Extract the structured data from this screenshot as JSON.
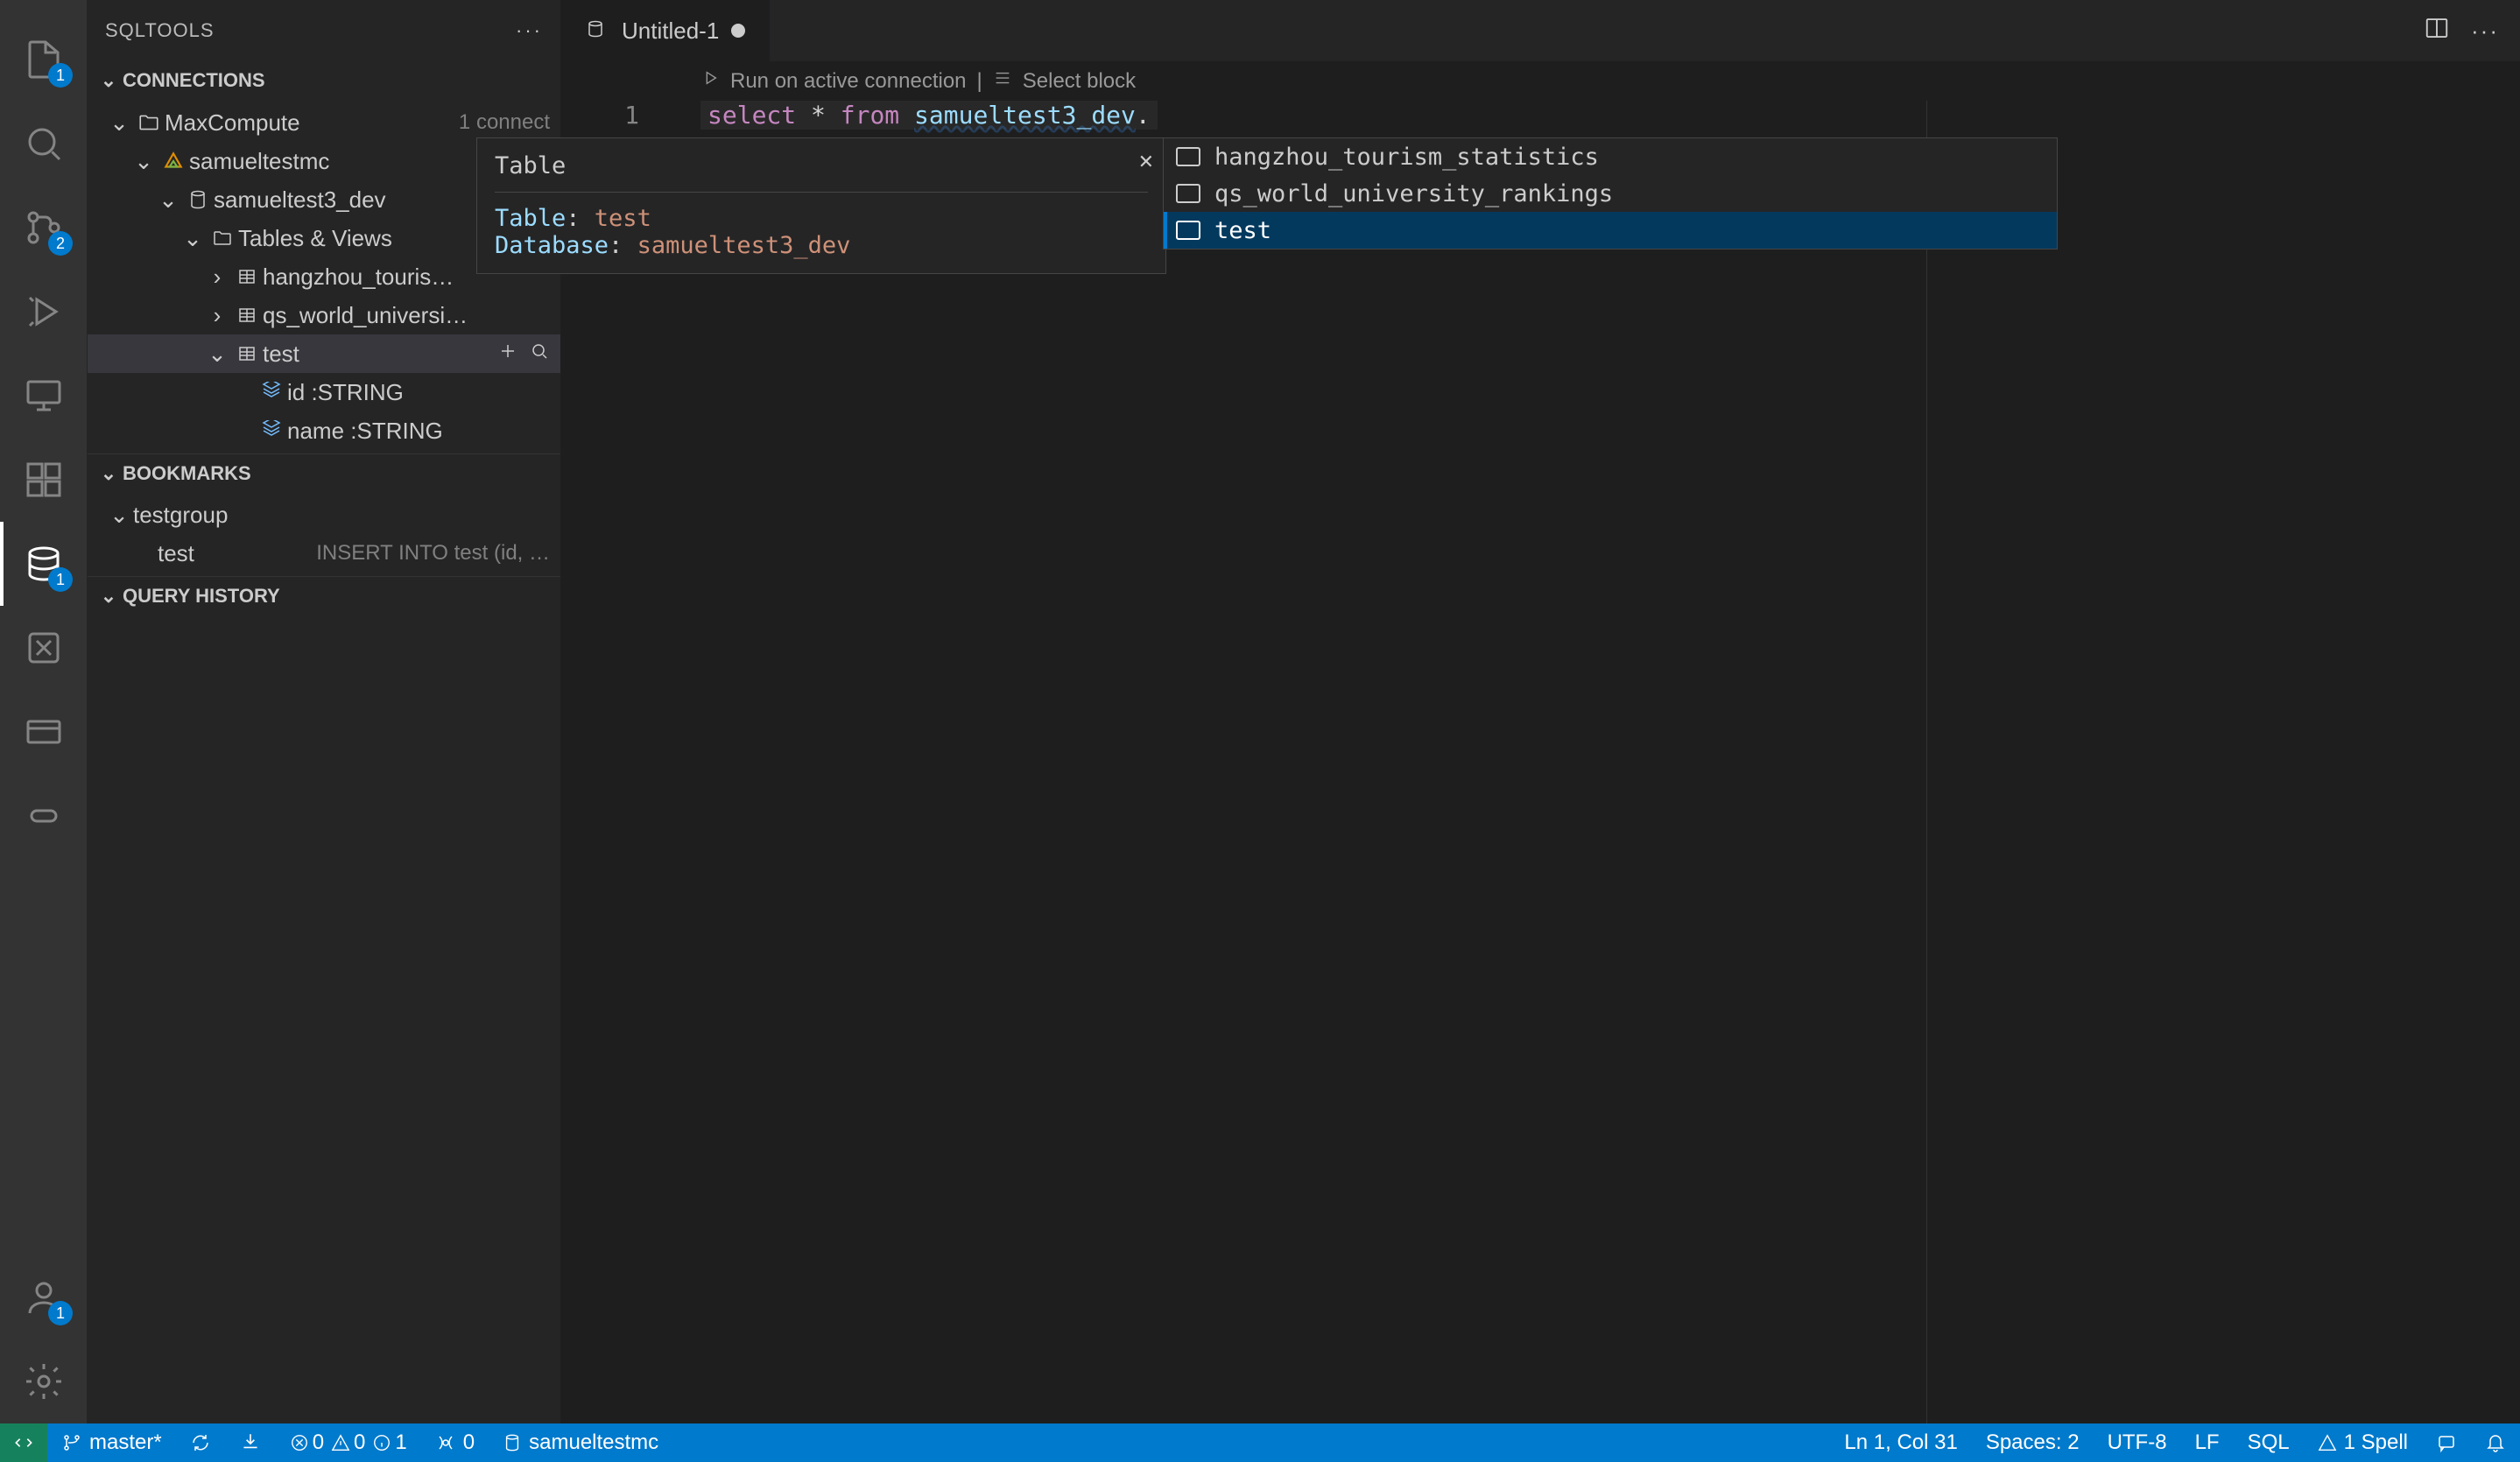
{
  "sidebar": {
    "title": "SQLTOOLS",
    "sections": {
      "connections": "CONNECTIONS",
      "bookmarks": "BOOKMARKS",
      "query_history": "QUERY HISTORY"
    }
  },
  "connections": {
    "driver": {
      "name": "MaxCompute",
      "desc": "1 connect"
    },
    "conn": {
      "name": "samueltestmc",
      "desc": "/"
    },
    "db": {
      "name": "samueltest3_dev"
    },
    "group": {
      "name": "Tables & Views"
    },
    "tables": [
      {
        "name": "hangzhou_touris…"
      },
      {
        "name": "qs_world_universi…"
      },
      {
        "name": "test"
      }
    ],
    "columns": [
      {
        "name": "id :STRING"
      },
      {
        "name": "name :STRING"
      }
    ]
  },
  "bookmarks": {
    "group": "testgroup",
    "item": {
      "name": "test",
      "desc": "INSERT INTO test (id, …"
    }
  },
  "tab": {
    "label": "Untitled-1"
  },
  "codelens": {
    "run": "Run on active connection",
    "sep": "|",
    "select_block": "Select block"
  },
  "editor": {
    "line_number": "1",
    "kw_select": "select",
    "star": "*",
    "kw_from": "from",
    "ident": "samueltest3_dev",
    "dot": "."
  },
  "suggestions": {
    "items": [
      "hangzhou_tourism_statistics",
      "qs_world_university_rankings",
      "test"
    ],
    "selected_index": 2
  },
  "doc": {
    "heading": "Table",
    "k_table": "Table",
    "v_table": "test",
    "k_db": "Database",
    "v_db": "samueltest3_dev"
  },
  "status": {
    "branch": "master*",
    "errors": "0",
    "warnings": "0",
    "infos": "1",
    "ports": "0",
    "connection": "samueltestmc",
    "ln_col": "Ln 1, Col 31",
    "spaces": "Spaces: 2",
    "encoding": "UTF-8",
    "eol": "LF",
    "lang": "SQL",
    "spell": "1 Spell"
  },
  "badges": {
    "explorer": "1",
    "scm": "2",
    "sqltools": "1",
    "account": "1"
  }
}
